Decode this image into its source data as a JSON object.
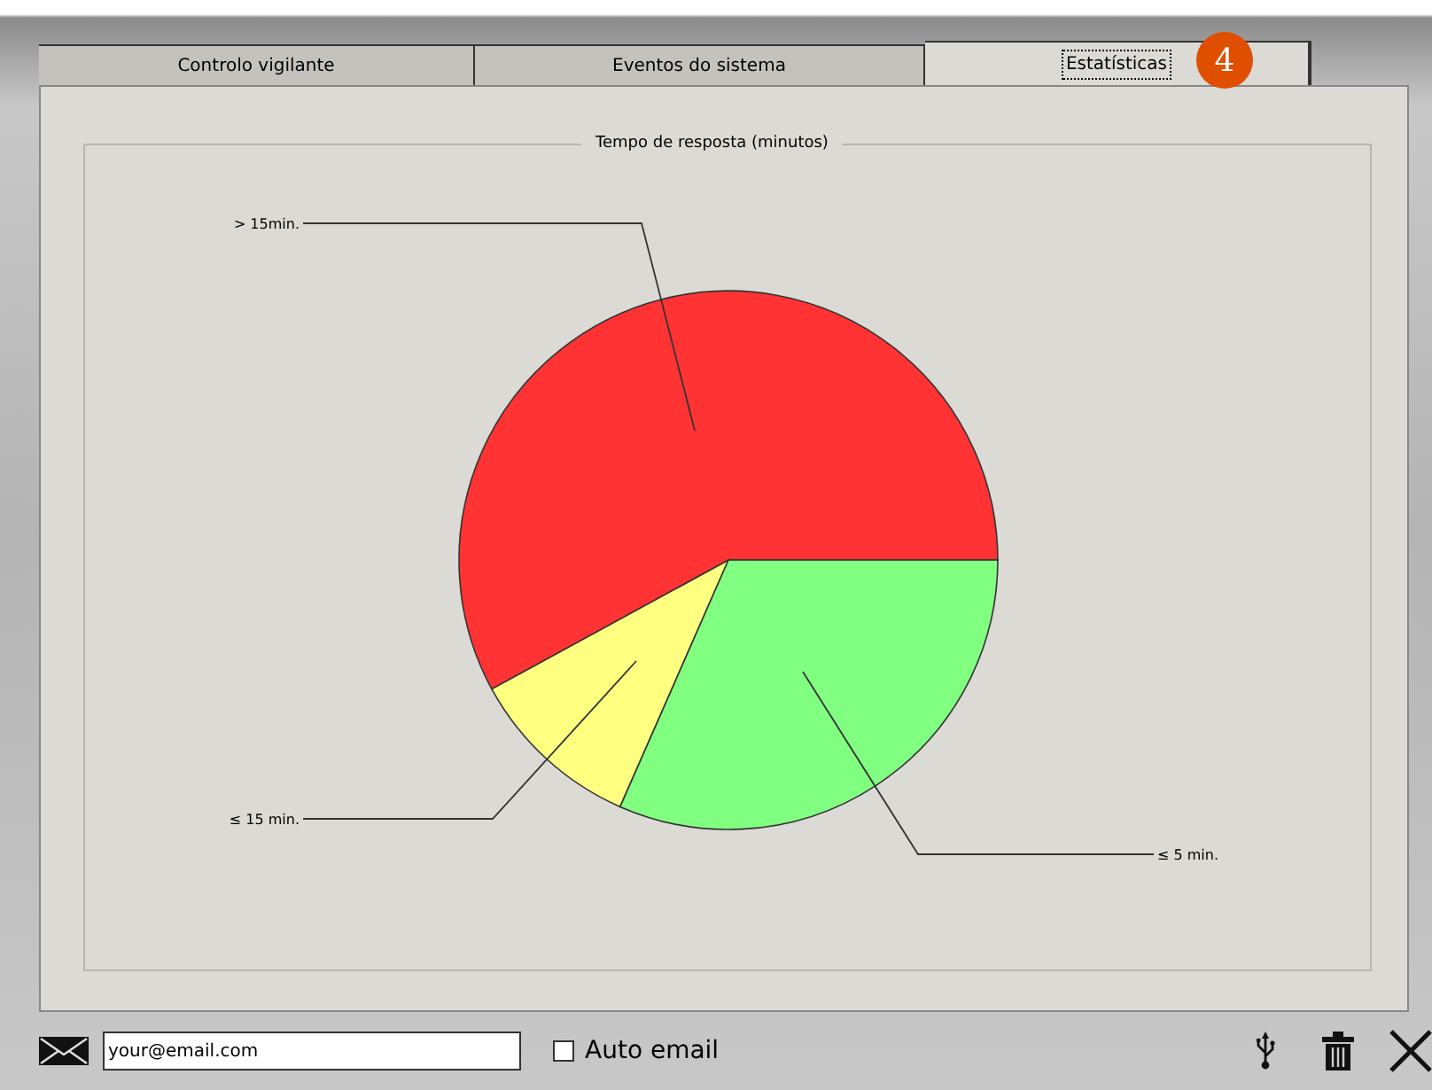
{
  "tabs": [
    {
      "label": "Controlo vigilante",
      "selected": false
    },
    {
      "label": "Eventos do sistema",
      "selected": false
    },
    {
      "label": "Estatísticas",
      "selected": true
    }
  ],
  "badge": "4",
  "group": {
    "title": "Tempo de resposta (minutos)",
    "slices": [
      {
        "label": "> 15min.",
        "color": "#ff3333"
      },
      {
        "label": "≤ 15 min.",
        "color": "#ffff80"
      },
      {
        "label": "≤ 5 min.",
        "color": "#80ff80"
      }
    ]
  },
  "bottom": {
    "email": {
      "value": "your@email.com"
    },
    "auto_email": {
      "label": "Auto email",
      "checked": false
    }
  }
}
